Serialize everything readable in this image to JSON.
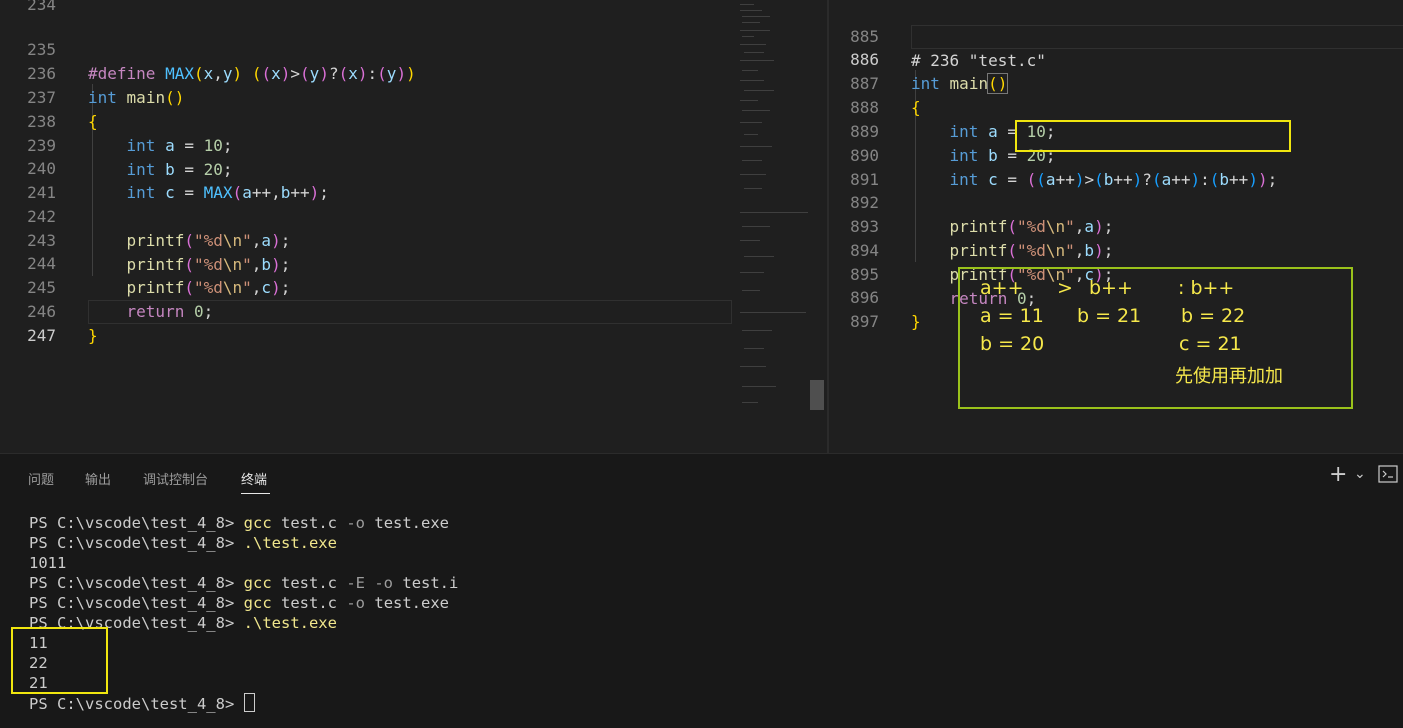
{
  "left_editor": {
    "lines": [
      {
        "n": "234"
      },
      {
        "n": "235"
      },
      {
        "n": "236"
      },
      {
        "n": "237"
      },
      {
        "n": "238"
      },
      {
        "n": "239"
      },
      {
        "n": "240"
      },
      {
        "n": "241"
      },
      {
        "n": "242"
      },
      {
        "n": "243"
      },
      {
        "n": "244"
      },
      {
        "n": "245"
      },
      {
        "n": "246"
      },
      {
        "n": "247"
      }
    ],
    "code": {
      "define_kw": "#define",
      "macro_name": "MAX",
      "int_kw": "int",
      "main": "main",
      "a": "a",
      "b": "b",
      "c": "c",
      "ten": "10",
      "twenty": "20",
      "zero": "0",
      "printf": "printf",
      "fmt": "%d",
      "nl": "\\n",
      "return": "return"
    }
  },
  "right_editor": {
    "lines": [
      {
        "n": "885"
      },
      {
        "n": "886"
      },
      {
        "n": "887"
      },
      {
        "n": "888"
      },
      {
        "n": "889"
      },
      {
        "n": "890"
      },
      {
        "n": "891"
      },
      {
        "n": "892"
      },
      {
        "n": "893"
      },
      {
        "n": "894"
      },
      {
        "n": "895"
      },
      {
        "n": "896"
      },
      {
        "n": "897"
      }
    ],
    "line_marker": "# 236 \"test.c\""
  },
  "annotation": {
    "row1": [
      "a++",
      ">",
      "b++",
      ": b++"
    ],
    "row2": [
      "a = 11",
      "b = 21",
      "b = 22"
    ],
    "row3": [
      "b = 20",
      "c = 21"
    ],
    "note": "先使用再加加"
  },
  "panel": {
    "tabs": [
      "问题",
      "输出",
      "调试控制台",
      "终端"
    ],
    "active_tab": "终端",
    "add_icon": "+",
    "chevron": "⌄"
  },
  "terminal": {
    "prompt": "PS C:\\vscode\\test_4_8>",
    "lines": [
      {
        "cmd": "gcc",
        "args": "test.c",
        "opt": "-o",
        "tail": "test.exe"
      },
      {
        "cmd": ".\\test.exe"
      },
      {
        "out": "1011"
      },
      {
        "cmd": "gcc",
        "args": "test.c",
        "opt": "-E -o",
        "tail": "test.i"
      },
      {
        "cmd": "gcc",
        "args": "test.c",
        "opt": "-o",
        "tail": "test.exe"
      },
      {
        "cmd": ".\\test.exe"
      },
      {
        "out": "11"
      },
      {
        "out": "22"
      },
      {
        "out": "21"
      }
    ]
  },
  "colors": {
    "highlight_yellow": "#f0e60f",
    "annotation_green": "#9ac21b"
  }
}
